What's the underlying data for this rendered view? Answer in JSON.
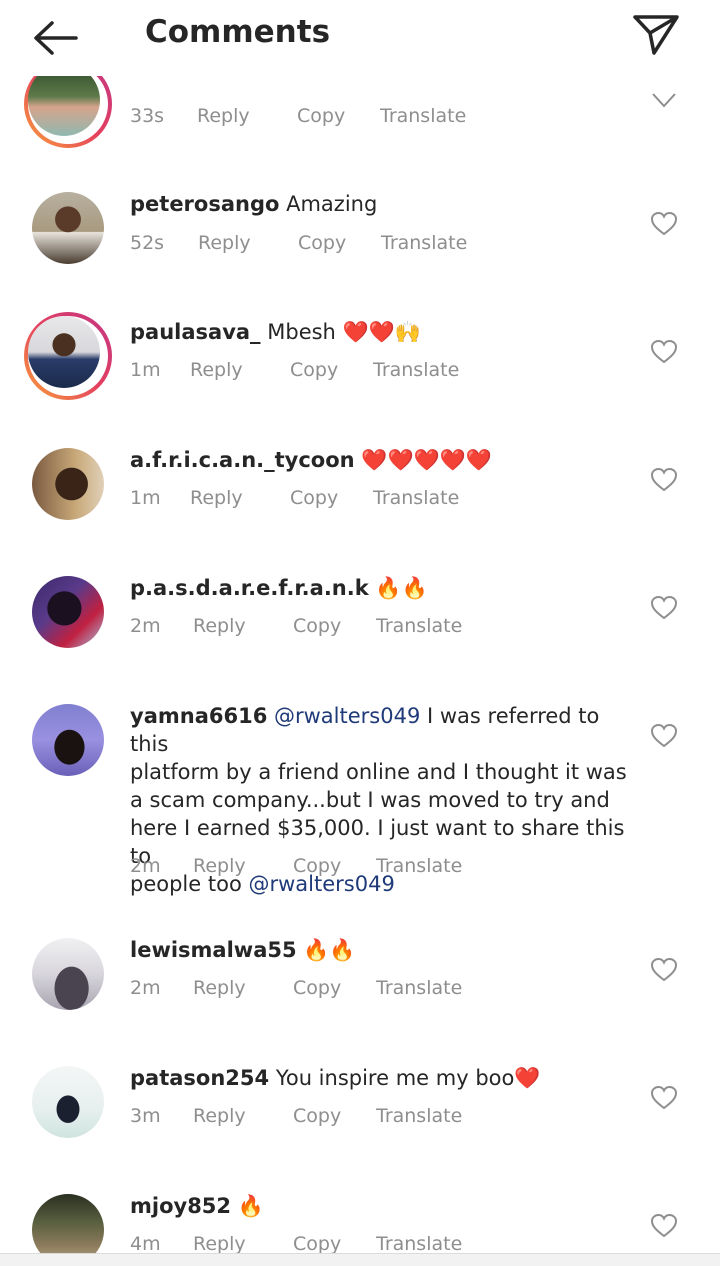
{
  "header": {
    "title": "Comments"
  },
  "comments": [
    {
      "user": "",
      "text": "",
      "time": "33s",
      "reply": "Reply",
      "copy": "Copy",
      "translate": "Translate"
    },
    {
      "user": "peterosango",
      "text": "Amazing",
      "time": "52s",
      "reply": "Reply",
      "copy": "Copy",
      "translate": "Translate"
    },
    {
      "user": "paulasava_",
      "text": "Mbesh ❤️❤️🙌",
      "time": "1m",
      "reply": "Reply",
      "copy": "Copy",
      "translate": "Translate"
    },
    {
      "user": "a.f.r.i.c.a.n._tycoon",
      "text": "❤️❤️❤️❤️❤️",
      "time": "1m",
      "reply": "Reply",
      "copy": "Copy",
      "translate": "Translate"
    },
    {
      "user": "p.a.s.d.a.r.e.f.r.a.n.k",
      "text": "🔥🔥",
      "time": "2m",
      "reply": "Reply",
      "copy": "Copy",
      "translate": "Translate"
    },
    {
      "user": "yamna6616",
      "mention1": "@rwalters049",
      "text_line1": "I was referred to this",
      "text_line2": "platform by a friend online and I thought it was",
      "text_line3": "a scam company...but I was moved to try and",
      "text_line4": "here I earned $35,000. I just want to share this to",
      "text_line5": "people too",
      "mention2": "@rwalters049",
      "time": "2m",
      "reply": "Reply",
      "copy": "Copy",
      "translate": "Translate"
    },
    {
      "user": "lewismalwa55",
      "text": "🔥🔥",
      "time": "2m",
      "reply": "Reply",
      "copy": "Copy",
      "translate": "Translate"
    },
    {
      "user": "patason254",
      "text": "You inspire me my boo❤️",
      "time": "3m",
      "reply": "Reply",
      "copy": "Copy",
      "translate": "Translate"
    },
    {
      "user": "mjoy852",
      "text": "🔥",
      "time": "4m",
      "reply": "Reply",
      "copy": "Copy",
      "translate": "Translate"
    }
  ],
  "icons": {
    "back": "arrow-left-icon",
    "send": "paper-plane-icon",
    "like": "heart-outline-icon"
  },
  "colors": {
    "text": "#262626",
    "meta": "#8e8e8e",
    "mention": "#1f3a78",
    "ring_start": "#f9a33a",
    "ring_end": "#c13584"
  }
}
